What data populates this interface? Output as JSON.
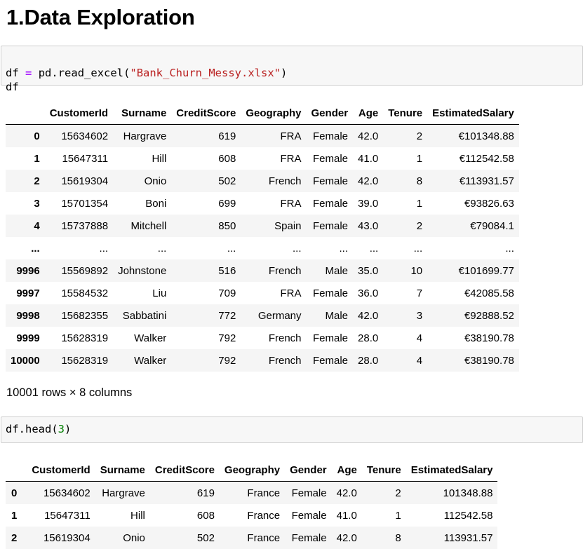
{
  "heading": "1.Data Exploration",
  "cell1": {
    "line1": {
      "var": "df",
      "op": "=",
      "call": "pd.read_excel(",
      "arg": "\"Bank_Churn_Messy.xlsx\"",
      "close": ")"
    },
    "line2": "df"
  },
  "table1": {
    "columns": [
      "",
      "CustomerId",
      "Surname",
      "CreditScore",
      "Geography",
      "Gender",
      "Age",
      "Tenure",
      "EstimatedSalary"
    ],
    "rows": [
      [
        "0",
        "15634602",
        "Hargrave",
        "619",
        "FRA",
        "Female",
        "42.0",
        "2",
        "€101348.88"
      ],
      [
        "1",
        "15647311",
        "Hill",
        "608",
        "FRA",
        "Female",
        "41.0",
        "1",
        "€112542.58"
      ],
      [
        "2",
        "15619304",
        "Onio",
        "502",
        "French",
        "Female",
        "42.0",
        "8",
        "€113931.57"
      ],
      [
        "3",
        "15701354",
        "Boni",
        "699",
        "FRA",
        "Female",
        "39.0",
        "1",
        "€93826.63"
      ],
      [
        "4",
        "15737888",
        "Mitchell",
        "850",
        "Spain",
        "Female",
        "43.0",
        "2",
        "€79084.1"
      ],
      [
        "...",
        "...",
        "...",
        "...",
        "...",
        "...",
        "...",
        "...",
        "..."
      ],
      [
        "9996",
        "15569892",
        "Johnstone",
        "516",
        "French",
        "Male",
        "35.0",
        "10",
        "€101699.77"
      ],
      [
        "9997",
        "15584532",
        "Liu",
        "709",
        "FRA",
        "Female",
        "36.0",
        "7",
        "€42085.58"
      ],
      [
        "9998",
        "15682355",
        "Sabbatini",
        "772",
        "Germany",
        "Male",
        "42.0",
        "3",
        "€92888.52"
      ],
      [
        "9999",
        "15628319",
        "Walker",
        "792",
        "French",
        "Female",
        "28.0",
        "4",
        "€38190.78"
      ],
      [
        "10000",
        "15628319",
        "Walker",
        "792",
        "French",
        "Female",
        "28.0",
        "4",
        "€38190.78"
      ]
    ]
  },
  "shape_note": "10001 rows × 8 columns",
  "cell2": {
    "call": "df.head(",
    "arg": "3",
    "close": ")"
  },
  "table2": {
    "columns": [
      "",
      "CustomerId",
      "Surname",
      "CreditScore",
      "Geography",
      "Gender",
      "Age",
      "Tenure",
      "EstimatedSalary"
    ],
    "rows": [
      [
        "0",
        "15634602",
        "Hargrave",
        "619",
        "France",
        "Female",
        "42.0",
        "2",
        "101348.88"
      ],
      [
        "1",
        "15647311",
        "Hill",
        "608",
        "France",
        "Female",
        "41.0",
        "1",
        "112542.58"
      ],
      [
        "2",
        "15619304",
        "Onio",
        "502",
        "France",
        "Female",
        "42.0",
        "8",
        "113931.57"
      ]
    ]
  }
}
